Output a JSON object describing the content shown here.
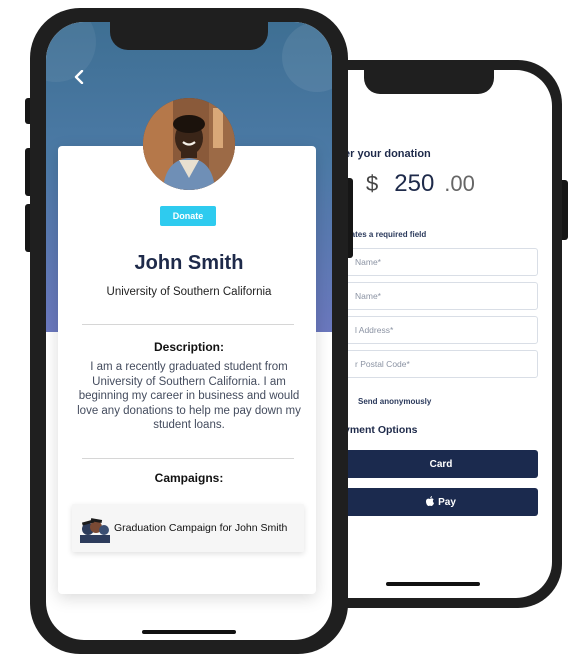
{
  "profile": {
    "donate_label": "Donate",
    "name": "John Smith",
    "school": "University of Southern California",
    "description_title": "Description:",
    "description": "I am a recently graduated student from University of Southern California. I am beginning my career in business and would love any donations to help me pay down my student loans.",
    "campaigns_title": "Campaigns:",
    "campaigns": [
      {
        "title": "Graduation Campaign for John Smith"
      }
    ]
  },
  "donation": {
    "title": "er your donation",
    "currency_symbol": "$",
    "amount_whole": "250",
    "amount_cents": ".00",
    "required_note": "icates a required field",
    "fields": [
      {
        "placeholder": "Name*"
      },
      {
        "placeholder": "Name*"
      },
      {
        "placeholder": "l Address*"
      },
      {
        "placeholder": "r Postal Code*"
      }
    ],
    "anonymous_label": "Send anonymously",
    "payment_title": "yment Options",
    "pay_card_label": "Card",
    "pay_apple_label": "Pay"
  },
  "icons": {
    "back": "chevron-left-icon",
    "apple": "apple-icon"
  },
  "colors": {
    "header_blue": "#3e6f93",
    "header_purple": "#6b78be",
    "donate_button": "#2ecbef",
    "navy": "#1b2a4e",
    "name_text": "#1e2a4a"
  }
}
